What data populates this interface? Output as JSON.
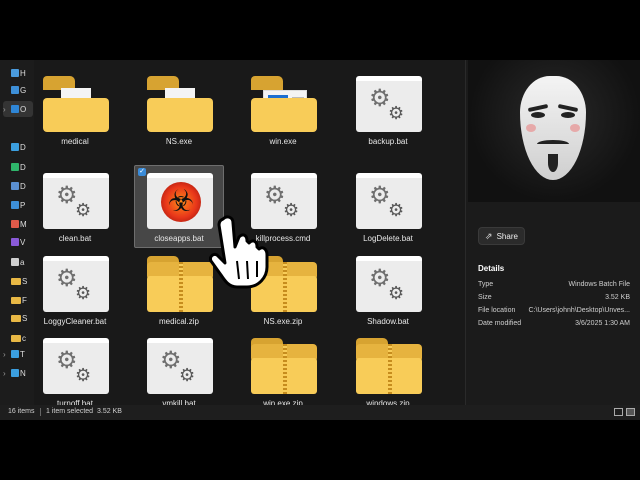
{
  "nav": {
    "items": [
      {
        "icon": "home-icon",
        "label": "H",
        "selected": false,
        "chevron": false,
        "color": "#4a9bde"
      },
      {
        "icon": "gallery-icon",
        "label": "G",
        "selected": false,
        "chevron": false,
        "color": "#3d8fd8"
      },
      {
        "icon": "onedrive-icon",
        "label": "O",
        "selected": true,
        "chevron": true,
        "color": "#2f86d6"
      },
      {
        "icon": "desktop-icon",
        "label": "D",
        "selected": false,
        "chevron": false,
        "color": "#3b9fe0"
      },
      {
        "icon": "downloads-icon",
        "label": "D",
        "selected": false,
        "chevron": false,
        "color": "#2fb56b"
      },
      {
        "icon": "documents-icon",
        "label": "D",
        "selected": false,
        "chevron": false,
        "color": "#5a8fd0"
      },
      {
        "icon": "pictures-icon",
        "label": "P",
        "selected": false,
        "chevron": false,
        "color": "#3d8fd8"
      },
      {
        "icon": "music-icon",
        "label": "M",
        "selected": false,
        "chevron": false,
        "color": "#e05a4a"
      },
      {
        "icon": "videos-icon",
        "label": "V",
        "selected": false,
        "chevron": false,
        "color": "#8a5ad8"
      },
      {
        "icon": "drive-icon",
        "label": "a",
        "selected": false,
        "chevron": false,
        "color": "#cfcfcf"
      },
      {
        "icon": "folder-icon",
        "label": "S",
        "selected": false,
        "chevron": false,
        "color": "#e8b845"
      },
      {
        "icon": "folder-icon",
        "label": "F",
        "selected": false,
        "chevron": false,
        "color": "#e8b845"
      },
      {
        "icon": "folder-icon",
        "label": "S",
        "selected": false,
        "chevron": false,
        "color": "#e8b845"
      },
      {
        "icon": "folder-icon",
        "label": "c",
        "selected": false,
        "chevron": false,
        "color": "#e8b845"
      },
      {
        "icon": "this-pc-icon",
        "label": "T",
        "selected": false,
        "chevron": true,
        "color": "#3b9fe0"
      },
      {
        "icon": "network-icon",
        "label": "N",
        "selected": false,
        "chevron": true,
        "color": "#3b9fe0"
      }
    ]
  },
  "files": [
    {
      "name": "medical",
      "type": "folder-doc",
      "selected": false
    },
    {
      "name": "NS.exe",
      "type": "folder-doc",
      "selected": false
    },
    {
      "name": "win.exe",
      "type": "folder-media",
      "selected": false
    },
    {
      "name": "backup.bat",
      "type": "bat",
      "selected": false
    },
    {
      "name": "clean.bat",
      "type": "bat",
      "selected": false
    },
    {
      "name": "closeapps.bat",
      "type": "biohazard",
      "selected": true
    },
    {
      "name": "killprocess.cmd",
      "type": "bat",
      "selected": false
    },
    {
      "name": "LogDelete.bat",
      "type": "bat",
      "selected": false
    },
    {
      "name": "LoggyCleaner.bat",
      "type": "bat",
      "selected": false
    },
    {
      "name": "medical.zip",
      "type": "zip",
      "selected": false
    },
    {
      "name": "NS.exe.zip",
      "type": "zip",
      "selected": false
    },
    {
      "name": "Shadow.bat",
      "type": "bat",
      "selected": false
    },
    {
      "name": "turnoff.bat",
      "type": "bat",
      "selected": false
    },
    {
      "name": "vmkill.bat",
      "type": "bat",
      "selected": false
    },
    {
      "name": "win.exe.zip",
      "type": "zip",
      "selected": false
    },
    {
      "name": "windows.zip",
      "type": "zip",
      "selected": false
    }
  ],
  "preview": {
    "image": "anonymous-mask-image",
    "share_label": "Share",
    "details_title": "Details",
    "details": [
      {
        "key": "Type",
        "value": "Windows Batch File"
      },
      {
        "key": "Size",
        "value": "3.52 KB"
      },
      {
        "key": "File location",
        "value": "C:\\Users\\johnh\\Desktop\\Unves..."
      },
      {
        "key": "Date modified",
        "value": "3/6/2025 1:30 AM"
      }
    ]
  },
  "status": {
    "item_count": "16 items",
    "selection": "1 item selected",
    "selection_size": "3.52 KB"
  },
  "colors": {
    "selection_check": "#3a8bd8",
    "folder_yellow": "#f8cc58"
  }
}
